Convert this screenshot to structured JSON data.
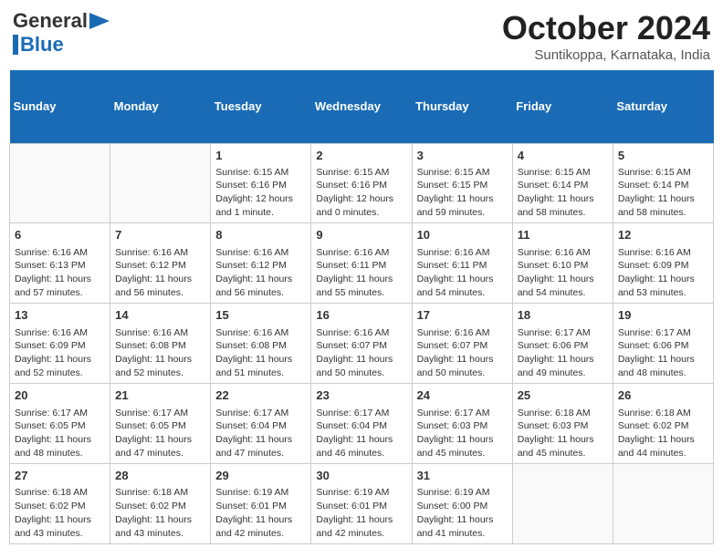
{
  "logo": {
    "line1": "General",
    "line2": "Blue"
  },
  "title": "October 2024",
  "subtitle": "Suntikoppa, Karnataka, India",
  "headers": [
    "Sunday",
    "Monday",
    "Tuesday",
    "Wednesday",
    "Thursday",
    "Friday",
    "Saturday"
  ],
  "weeks": [
    [
      {
        "day": "",
        "info": ""
      },
      {
        "day": "",
        "info": ""
      },
      {
        "day": "1",
        "info": "Sunrise: 6:15 AM\nSunset: 6:16 PM\nDaylight: 12 hours\nand 1 minute."
      },
      {
        "day": "2",
        "info": "Sunrise: 6:15 AM\nSunset: 6:16 PM\nDaylight: 12 hours\nand 0 minutes."
      },
      {
        "day": "3",
        "info": "Sunrise: 6:15 AM\nSunset: 6:15 PM\nDaylight: 11 hours\nand 59 minutes."
      },
      {
        "day": "4",
        "info": "Sunrise: 6:15 AM\nSunset: 6:14 PM\nDaylight: 11 hours\nand 58 minutes."
      },
      {
        "day": "5",
        "info": "Sunrise: 6:15 AM\nSunset: 6:14 PM\nDaylight: 11 hours\nand 58 minutes."
      }
    ],
    [
      {
        "day": "6",
        "info": "Sunrise: 6:16 AM\nSunset: 6:13 PM\nDaylight: 11 hours\nand 57 minutes."
      },
      {
        "day": "7",
        "info": "Sunrise: 6:16 AM\nSunset: 6:12 PM\nDaylight: 11 hours\nand 56 minutes."
      },
      {
        "day": "8",
        "info": "Sunrise: 6:16 AM\nSunset: 6:12 PM\nDaylight: 11 hours\nand 56 minutes."
      },
      {
        "day": "9",
        "info": "Sunrise: 6:16 AM\nSunset: 6:11 PM\nDaylight: 11 hours\nand 55 minutes."
      },
      {
        "day": "10",
        "info": "Sunrise: 6:16 AM\nSunset: 6:11 PM\nDaylight: 11 hours\nand 54 minutes."
      },
      {
        "day": "11",
        "info": "Sunrise: 6:16 AM\nSunset: 6:10 PM\nDaylight: 11 hours\nand 54 minutes."
      },
      {
        "day": "12",
        "info": "Sunrise: 6:16 AM\nSunset: 6:09 PM\nDaylight: 11 hours\nand 53 minutes."
      }
    ],
    [
      {
        "day": "13",
        "info": "Sunrise: 6:16 AM\nSunset: 6:09 PM\nDaylight: 11 hours\nand 52 minutes."
      },
      {
        "day": "14",
        "info": "Sunrise: 6:16 AM\nSunset: 6:08 PM\nDaylight: 11 hours\nand 52 minutes."
      },
      {
        "day": "15",
        "info": "Sunrise: 6:16 AM\nSunset: 6:08 PM\nDaylight: 11 hours\nand 51 minutes."
      },
      {
        "day": "16",
        "info": "Sunrise: 6:16 AM\nSunset: 6:07 PM\nDaylight: 11 hours\nand 50 minutes."
      },
      {
        "day": "17",
        "info": "Sunrise: 6:16 AM\nSunset: 6:07 PM\nDaylight: 11 hours\nand 50 minutes."
      },
      {
        "day": "18",
        "info": "Sunrise: 6:17 AM\nSunset: 6:06 PM\nDaylight: 11 hours\nand 49 minutes."
      },
      {
        "day": "19",
        "info": "Sunrise: 6:17 AM\nSunset: 6:06 PM\nDaylight: 11 hours\nand 48 minutes."
      }
    ],
    [
      {
        "day": "20",
        "info": "Sunrise: 6:17 AM\nSunset: 6:05 PM\nDaylight: 11 hours\nand 48 minutes."
      },
      {
        "day": "21",
        "info": "Sunrise: 6:17 AM\nSunset: 6:05 PM\nDaylight: 11 hours\nand 47 minutes."
      },
      {
        "day": "22",
        "info": "Sunrise: 6:17 AM\nSunset: 6:04 PM\nDaylight: 11 hours\nand 47 minutes."
      },
      {
        "day": "23",
        "info": "Sunrise: 6:17 AM\nSunset: 6:04 PM\nDaylight: 11 hours\nand 46 minutes."
      },
      {
        "day": "24",
        "info": "Sunrise: 6:17 AM\nSunset: 6:03 PM\nDaylight: 11 hours\nand 45 minutes."
      },
      {
        "day": "25",
        "info": "Sunrise: 6:18 AM\nSunset: 6:03 PM\nDaylight: 11 hours\nand 45 minutes."
      },
      {
        "day": "26",
        "info": "Sunrise: 6:18 AM\nSunset: 6:02 PM\nDaylight: 11 hours\nand 44 minutes."
      }
    ],
    [
      {
        "day": "27",
        "info": "Sunrise: 6:18 AM\nSunset: 6:02 PM\nDaylight: 11 hours\nand 43 minutes."
      },
      {
        "day": "28",
        "info": "Sunrise: 6:18 AM\nSunset: 6:02 PM\nDaylight: 11 hours\nand 43 minutes."
      },
      {
        "day": "29",
        "info": "Sunrise: 6:19 AM\nSunset: 6:01 PM\nDaylight: 11 hours\nand 42 minutes."
      },
      {
        "day": "30",
        "info": "Sunrise: 6:19 AM\nSunset: 6:01 PM\nDaylight: 11 hours\nand 42 minutes."
      },
      {
        "day": "31",
        "info": "Sunrise: 6:19 AM\nSunset: 6:00 PM\nDaylight: 11 hours\nand 41 minutes."
      },
      {
        "day": "",
        "info": ""
      },
      {
        "day": "",
        "info": ""
      }
    ]
  ]
}
